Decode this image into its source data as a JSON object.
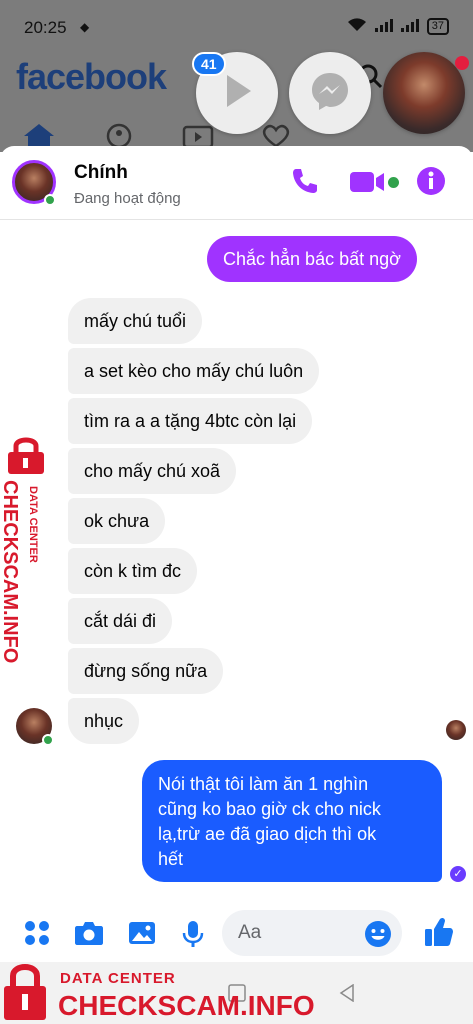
{
  "status_bar": {
    "time": "20:25",
    "battery": "37"
  },
  "facebook": {
    "logo": "facebook"
  },
  "chat_heads": {
    "badge_count": "41"
  },
  "conversation": {
    "contact_name": "Chính",
    "contact_status": "Đang hoạt động"
  },
  "messages": [
    {
      "direction": "outgoing",
      "text": "Chắc hẳn bác bất ngờ"
    },
    {
      "direction": "incoming",
      "text": "mấy chú tuổi"
    },
    {
      "direction": "incoming",
      "text": "a set kèo cho mấy chú luôn"
    },
    {
      "direction": "incoming",
      "text": "tìm ra a a tặng 4btc còn lại"
    },
    {
      "direction": "incoming",
      "text": "cho mấy chú xoã"
    },
    {
      "direction": "incoming",
      "text": "ok chưa"
    },
    {
      "direction": "incoming",
      "text": "còn k tìm đc"
    },
    {
      "direction": "incoming",
      "text": "cắt dái đi"
    },
    {
      "direction": "incoming",
      "text": "đừng sống nữa"
    },
    {
      "direction": "incoming",
      "text": "nhục"
    },
    {
      "direction": "outgoing",
      "lines": [
        "Nói thật tôi làm ăn 1 nghìn",
        "cũng ko bao giờ ck cho nick",
        "lạ,trừ ae đã giao dịch thì ok",
        "hết"
      ]
    }
  ],
  "composer": {
    "placeholder": "Aa"
  },
  "watermark": {
    "top_label": "DATA CENTER",
    "brand": "CHECKSCAM.INFO"
  },
  "colors": {
    "accent_purple": "#a033ff",
    "outgoing_blue": "#1a5cff",
    "messenger_blue": "#1877f2",
    "online_green": "#31a24c",
    "watermark_red": "#d8192c"
  },
  "icons": {
    "header": [
      "phone-icon",
      "video-camera-icon",
      "info-icon"
    ],
    "composer": [
      "apps-icon",
      "camera-icon",
      "image-icon",
      "microphone-icon",
      "emoji-icon",
      "thumbs-up-icon"
    ],
    "chat_heads": [
      "play-icon",
      "messenger-icon"
    ]
  }
}
